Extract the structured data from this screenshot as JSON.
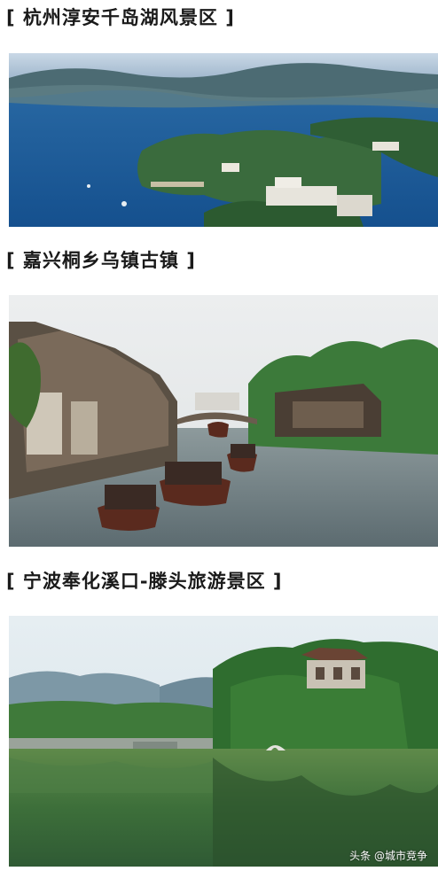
{
  "sections": [
    {
      "title": "[ 杭州淳安千岛湖风景区 ]",
      "image": "thousand-island-lake-aerial"
    },
    {
      "title": "[ 嘉兴桐乡乌镇古镇 ]",
      "image": "wuzhen-water-town-canal"
    },
    {
      "title": "[ 宁波奉化溪口-滕头旅游景区 ]",
      "image": "xikou-tengtou-lake-pavilion"
    }
  ],
  "watermark": "头条 @城市竞争",
  "colors": {
    "lake_blue": "#1f5f9e",
    "canal_water": "#6e7d82",
    "green_reflection": "#3d6f3a"
  }
}
